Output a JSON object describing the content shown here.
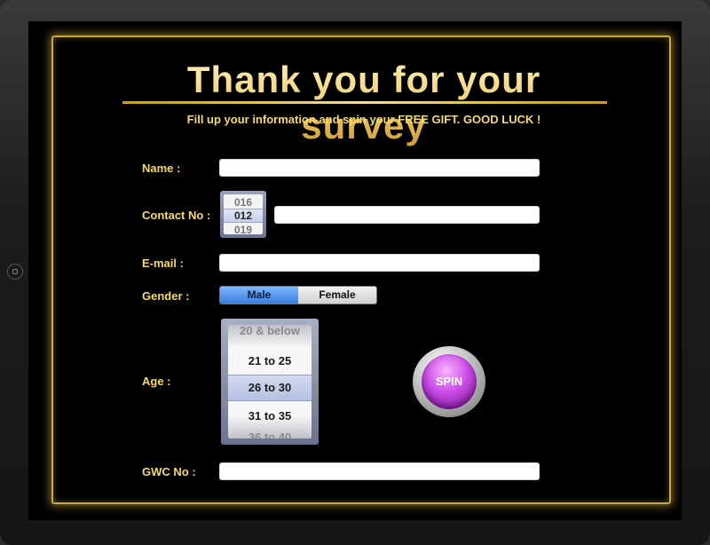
{
  "header": {
    "title": "Thank you for your survey",
    "subtitle": "Fill up your information and spin your FREE GIFT. GOOD LUCK !"
  },
  "form": {
    "name": {
      "label": "Name :",
      "value": ""
    },
    "contact": {
      "label": "Contact No :",
      "prefix_options": [
        "016",
        "012",
        "019"
      ],
      "prefix_selected": "012",
      "value": ""
    },
    "email": {
      "label": "E-mail :",
      "value": ""
    },
    "gender": {
      "label": "Gender :",
      "options": [
        "Male",
        "Female"
      ],
      "selected": "Male"
    },
    "age": {
      "label": "Age :",
      "options": [
        "20 & below",
        "21 to 25",
        "26 to 30",
        "31 to 35",
        "36 to 40"
      ],
      "selected": "26 to 30"
    },
    "gwc": {
      "label": "GWC No :",
      "value": ""
    }
  },
  "spin_button": {
    "label": "SPIN"
  },
  "colors": {
    "label_gold": "#f5d96b",
    "frame_gold": "#c9a545",
    "spin_purple": "#c94be6",
    "gender_active": "#3a7de0"
  }
}
